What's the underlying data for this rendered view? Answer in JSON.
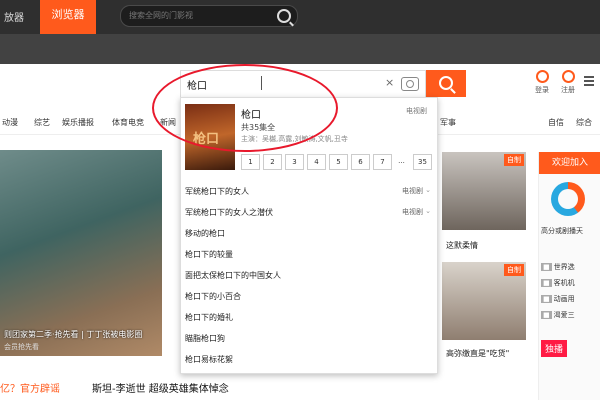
{
  "topbar": {
    "player_label": "放器",
    "browser_tab": "浏览器",
    "search_placeholder": "搜索全网的门影视"
  },
  "search": {
    "value": "枪口",
    "clear": "×"
  },
  "user": {
    "login": "登录",
    "register": "注册"
  },
  "nav": {
    "items": [
      "动漫",
      "综艺",
      "娱乐播报",
      "体育电竞",
      "新闻",
      "军事",
      "自信",
      "综合"
    ]
  },
  "dropdown": {
    "featured": {
      "poster_text": "枪口",
      "title": "枪口",
      "episodes_total": "共35集全",
      "cast": "主演：吴樾,高露,刘敏涛,文帆,丑寺",
      "type": "电视剧",
      "episodes": [
        "1",
        "2",
        "3",
        "4",
        "5",
        "6",
        "7",
        "...",
        "35"
      ]
    },
    "suggestions": [
      {
        "text": "军统枪口下的女人",
        "type": "电视剧",
        "chev": "⌄"
      },
      {
        "text": "军统枪口下的女人之潜伏",
        "type": "电视剧",
        "chev": "⌄"
      },
      {
        "text": "移动的枪口",
        "type": "",
        "chev": ""
      },
      {
        "text": "枪口下的较量",
        "type": "",
        "chev": ""
      },
      {
        "text": "面把太保枪口下的中国女人",
        "type": "",
        "chev": ""
      },
      {
        "text": "枪口下的小百合",
        "type": "",
        "chev": ""
      },
      {
        "text": "枪口下的婚礼",
        "type": "",
        "chev": ""
      },
      {
        "text": "瞄脂枪口狗",
        "type": "",
        "chev": ""
      },
      {
        "text": "枪口易标花絮",
        "type": "",
        "chev": ""
      }
    ]
  },
  "content": {
    "hero_caption": "则团家第二季·抢先看 | 丁丁张被电影圈",
    "hero_sub": "会员抢先看",
    "bottom_left": "亿？官方辟谣",
    "bottom_mid": "斯坦-李逝世 超级英雄集体悼念",
    "thumb1_tag": "自制",
    "thumb1_caption": "这默柔情",
    "thumb2_tag": "自制",
    "thumb2_caption": "高弥缴直是\"吃货\""
  },
  "right_panel": {
    "banner": "欢迎加入",
    "donut_label": "高分或剧播天",
    "rows": [
      "世界选",
      "客机机",
      "动画用",
      "渴爱三"
    ],
    "exclusive": "独播"
  },
  "colors": {
    "accent": "#ff5a1c",
    "annotation": "#e8192c",
    "topbar": "#2f2f2f"
  }
}
